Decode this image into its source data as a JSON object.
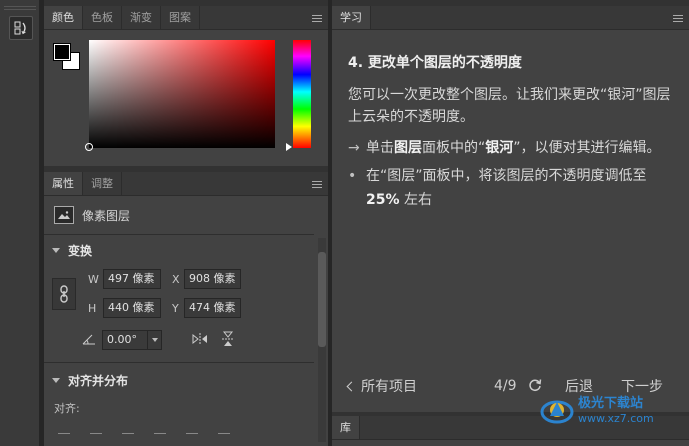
{
  "toolstrip": {
    "history_icon": "history-panel-icon"
  },
  "color_panel": {
    "tabs": [
      "颜色",
      "色板",
      "渐变",
      "图案"
    ],
    "active_tab": 0,
    "foreground_color": "#000000",
    "background_color": "#ffffff",
    "hue_color": "#ff0000"
  },
  "properties_panel": {
    "tabs": [
      "属性",
      "调整"
    ],
    "layer_type": "像素图层",
    "transform": {
      "title": "变换",
      "w_label": "W",
      "w_value": "497 像素",
      "h_label": "H",
      "h_value": "440 像素",
      "x_label": "X",
      "x_value": "908 像素",
      "y_label": "Y",
      "y_value": "474 像素",
      "angle_value": "0.00°"
    },
    "align": {
      "title": "对齐并分布",
      "label": "对齐:"
    }
  },
  "learn_panel": {
    "tab": "学习",
    "step_title": "4. 更改单个图层的不透明度",
    "intro": "您可以一次更改整个图层。让我们来更改“银河”图层上云朵的不透明度。",
    "step1_prefix": "单击",
    "step1_bold1": "图层",
    "step1_mid": "面板中的“",
    "step1_bold2": "银河",
    "step1_suffix": "”，以便对其进行编辑。",
    "step2_prefix": "在“图层”面板中，将该图层的不透明度调低至 ",
    "step2_bold": "25%",
    "step2_suffix": " 左右",
    "footer": {
      "all_items": "所有项目",
      "step_count": "4/9",
      "prev": "后退",
      "next": "下一步"
    }
  },
  "library_panel": {
    "tab": "库"
  },
  "watermark": {
    "name": "极光下载站",
    "url": "www.xz7.com"
  }
}
